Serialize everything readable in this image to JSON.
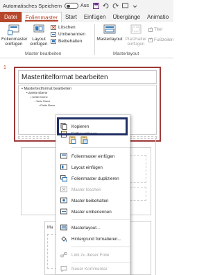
{
  "titlebar": {
    "autosave": "Automatisches Speichern",
    "toggle_state": "Aus"
  },
  "tabs": [
    "Datei",
    "Folienmaster",
    "Start",
    "Einfügen",
    "Übergänge",
    "Animatio"
  ],
  "ribbon": {
    "insert_master": "Folienmaster\neinfügen",
    "insert_layout": "Layout\neinfügen",
    "delete": "Löschen",
    "rename": "Umbenennen",
    "preserve": "Beibehalten",
    "group_master": "Master bearbeiten",
    "master_layout": "Masterlayout",
    "placeholder_insert": "Platzhalter\neinfügen",
    "title_cb": "Titel",
    "footer_cb": "Fußzeilen",
    "group_layout": "Masterlayout"
  },
  "thumbnail": {
    "number": "1",
    "title": "Mastertitelformat bearbeiten",
    "body": [
      "• Mastertextformat bearbeiten",
      "• Zweite Ebene",
      "• Dritte Ebene",
      "• Vierte Ebene",
      "• Fünfte Ebene"
    ],
    "layout_label": "Ma"
  },
  "context_menu": {
    "copy": "Kopieren",
    "paste_options": "Einfügeoptionen:",
    "insert_master": "Folienmaster einfügen",
    "insert_layout": "Layout einfügen",
    "duplicate_master": "Folienmaster duplizieren",
    "delete_master": "Master löschen",
    "preserve_master": "Master beibehalten",
    "rename_master": "Master umbenennen",
    "master_layout": "Masterlayout...",
    "format_background": "Hintergrund formatieren...",
    "link_to_slide": "Link zu dieser Folie",
    "new_comment": "Neuer Kommentar"
  },
  "colors": {
    "accent": "#b7472a",
    "highlight": "#1f2e63",
    "selection": "#9e3a3a"
  }
}
